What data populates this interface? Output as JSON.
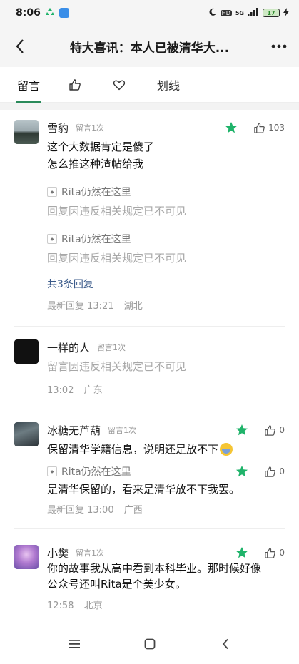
{
  "status": {
    "time": "8:06",
    "hd": "HD",
    "net": "5G",
    "battery": "17"
  },
  "header": {
    "title": "特大喜讯：本人已被清华大..."
  },
  "tabs": {
    "comments": "留言",
    "highlight": "划线"
  },
  "comments": [
    {
      "name": "雪豹",
      "tag": "留言1次",
      "likes": "103",
      "lines": [
        "这个大数据肯定是傻了",
        "怎么推这种渣帖给我"
      ],
      "replies": [
        {
          "name": "Rita仍然在这里",
          "text": "回复因违反相关规定已不可见"
        },
        {
          "name": "Rita仍然在这里",
          "text": "回复因违反相关规定已不可见"
        }
      ],
      "more": "共3条回复",
      "meta_time": "最新回复 13:21",
      "meta_loc": "湖北"
    },
    {
      "name": "一样的人",
      "tag": "留言1次",
      "text": "留言因违反相关规定已不可见",
      "meta_time": "13:02",
      "meta_loc": "广东"
    },
    {
      "name": "冰糖无芦葫",
      "tag": "留言1次",
      "likes": "0",
      "text": "保留清华学籍信息，说明还是放不下",
      "reply_name": "Rita仍然在这里",
      "reply_likes": "0",
      "reply_text": "是清华保留的，看来是清华放不下我罢。",
      "meta_time": "最新回复 13:00",
      "meta_loc": "广西"
    },
    {
      "name": "小樊",
      "tag": "留言1次",
      "likes": "0",
      "lines": [
        "你的故事我从高中看到本科毕业。那时候好像",
        "公众号还叫Rita是个美少女。"
      ],
      "meta_time": "12:58",
      "meta_loc": "北京"
    }
  ],
  "colors": {
    "star": "#1fb36a",
    "tab_underline": "#2a8a5a",
    "link": "#3a5a8a"
  }
}
